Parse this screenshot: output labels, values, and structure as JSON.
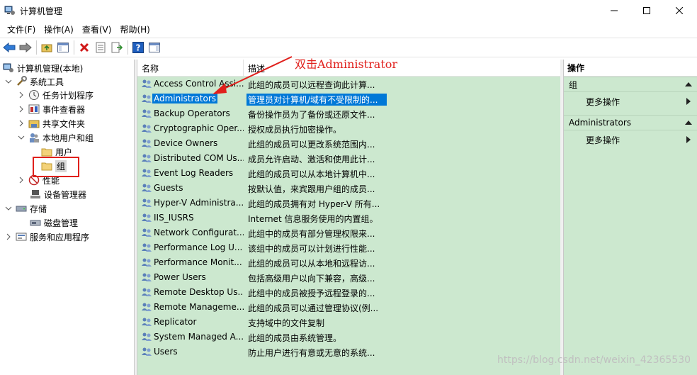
{
  "window": {
    "title": "计算机管理"
  },
  "menu": [
    "文件(F)",
    "操作(A)",
    "查看(V)",
    "帮助(H)"
  ],
  "tree": [
    {
      "label": "计算机管理(本地)",
      "icon": "computer-management-icon"
    },
    {
      "label": "系统工具",
      "icon": "system-tools-icon",
      "expanded": true
    },
    {
      "label": "任务计划程序",
      "icon": "clock-icon"
    },
    {
      "label": "事件查看器",
      "icon": "event-viewer-icon"
    },
    {
      "label": "共享文件夹",
      "icon": "shared-folder-icon"
    },
    {
      "label": "本地用户和组",
      "icon": "users-icon",
      "expanded": true
    },
    {
      "label": "用户",
      "icon": "folder-icon"
    },
    {
      "label": "组",
      "icon": "folder-icon",
      "selected": true
    },
    {
      "label": "性能",
      "icon": "performance-icon"
    },
    {
      "label": "设备管理器",
      "icon": "device-manager-icon"
    },
    {
      "label": "存储",
      "icon": "storage-icon",
      "expanded": true
    },
    {
      "label": "磁盘管理",
      "icon": "disk-icon"
    },
    {
      "label": "服务和应用程序",
      "icon": "services-icon"
    }
  ],
  "list": {
    "columns": {
      "name": "名称",
      "desc": "描述"
    },
    "rows": [
      {
        "name": "Access Control Assi...",
        "desc": "此组的成员可以远程查询此计算..."
      },
      {
        "name": "Administrators",
        "desc": "管理员对计算机/域有不受限制的...",
        "selected": true
      },
      {
        "name": "Backup Operators",
        "desc": "备份操作员为了备份或还原文件..."
      },
      {
        "name": "Cryptographic Oper...",
        "desc": "授权成员执行加密操作。"
      },
      {
        "name": "Device Owners",
        "desc": "此组的成员可以更改系统范围内..."
      },
      {
        "name": "Distributed COM Us...",
        "desc": "成员允许启动、激活和使用此计..."
      },
      {
        "name": "Event Log Readers",
        "desc": "此组的成员可以从本地计算机中..."
      },
      {
        "name": "Guests",
        "desc": "按默认值，来宾跟用户组的成员..."
      },
      {
        "name": "Hyper-V Administra...",
        "desc": "此组的成员拥有对 Hyper-V 所有..."
      },
      {
        "name": "IIS_IUSRS",
        "desc": "Internet 信息服务使用的内置组。"
      },
      {
        "name": "Network Configurat...",
        "desc": "此组中的成员有部分管理权限来..."
      },
      {
        "name": "Performance Log U...",
        "desc": "该组中的成员可以计划进行性能..."
      },
      {
        "name": "Performance Monit...",
        "desc": "此组的成员可以从本地和远程访..."
      },
      {
        "name": "Power Users",
        "desc": "包括高级用户以向下兼容，高级..."
      },
      {
        "name": "Remote Desktop Us...",
        "desc": "此组中的成员被授予远程登录的..."
      },
      {
        "name": "Remote Manageme...",
        "desc": "此组的成员可以通过管理协议(例..."
      },
      {
        "name": "Replicator",
        "desc": "支持域中的文件复制"
      },
      {
        "name": "System Managed A...",
        "desc": "此组的成员由系统管理。"
      },
      {
        "name": "Users",
        "desc": "防止用户进行有意或无意的系统..."
      }
    ]
  },
  "annotation": "双击Administrator",
  "actions": {
    "header": "操作",
    "sections": [
      {
        "title": "组",
        "item": "更多操作"
      },
      {
        "title": "Administrators",
        "item": "更多操作"
      }
    ]
  },
  "watermark": "https://blog.csdn.net/weixin_42365530",
  "colors": {
    "list_bg": "#cce8cf",
    "selection": "#0078d7",
    "annotation": "#e0201c"
  }
}
